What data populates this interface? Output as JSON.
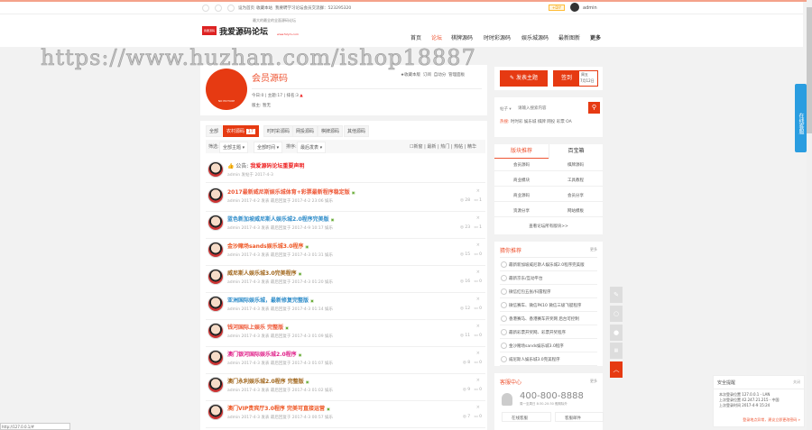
{
  "topbar": {
    "links": [
      "设为首页",
      "收藏本站",
      "我要聘学习论坛会员交流群：523295320"
    ],
    "badge": "+DIY",
    "user": "admin"
  },
  "header": {
    "logo_badge": "我要源码",
    "logo_text": "我爱源码论坛",
    "slogan": "最大的最全的全面源码论坛",
    "domain": "www.52ym.com"
  },
  "nav": [
    "首页",
    "论坛",
    "棋牌源码",
    "时时彩源码",
    "娱乐城源码",
    "最新图新",
    "更多"
  ],
  "watermark": "https://www.huzhan.com/ishop18887",
  "forum": {
    "title": "会员源码",
    "logo_text": "NO PICTURE",
    "stats": {
      "today_label": "今日:",
      "today": "0",
      "topics_label": "主题:",
      "topics": "17",
      "rank_label": "排名:",
      "rank": "3"
    },
    "moderator_label": "版主:",
    "moderator": "暂无",
    "actions": [
      "收藏本版",
      "订阅",
      "自动分",
      "管理面板"
    ]
  },
  "tabs": [
    "全部",
    "农村源码",
    "时时彩源码",
    "网投源码",
    "棋牌源码",
    "其他源码"
  ],
  "active_tab_count": "17",
  "filter": {
    "label": "筛选:",
    "type": "全部主题",
    "time": "全部时间",
    "sort_label": "排序:",
    "sort": "最后发表",
    "options": [
      "新窗",
      "最新",
      "热门",
      "热帖",
      "精华"
    ]
  },
  "announcement": {
    "prefix": "公告:",
    "title": "我爱源码论坛重要声明",
    "meta": "admin 发帖于 2017-4-3"
  },
  "topics": [
    {
      "title": "2017最新威尼斯娱乐城体育+彩票最新程序稳定版",
      "color": "#e53",
      "meta": "admin 2017-4-2 发表 最后回复于 2017-4-2 23:06 娱乐",
      "views": "28",
      "replies": "1"
    },
    {
      "title": "蓝色新加坡威尼斯人娱乐城2.0程序完美版",
      "color": "#2c8bc9",
      "meta": "admin 2017-4-3 发表 最后回复于 2017-4-9 10:17 娱乐",
      "views": "23",
      "replies": "1"
    },
    {
      "title": "金沙赌场sands娱乐城3.0程序",
      "color": "#ee5522",
      "meta": "admin 2017-4-3 发表 最后回复于 2017-4-3 01:31 娱乐",
      "views": "15",
      "replies": "0"
    },
    {
      "title": "威尼斯人娱乐城3.0完美程序",
      "color": "#a0651a",
      "meta": "admin 2017-4-3 发表 最后回复于 2017-4-3 01:20 娱乐",
      "views": "16",
      "replies": "0"
    },
    {
      "title": "亚洲国际娱乐城，最新修复完整版",
      "color": "#2c8bc9",
      "meta": "admin 2017-4-3 发表 最后回复于 2017-4-3 01:14 娱乐",
      "views": "12",
      "replies": "0"
    },
    {
      "title": "钱河国际上娱乐 完整版",
      "color": "#e53",
      "meta": "admin 2017-4-3 发表 最后回复于 2017-4-3 01:09 娱乐",
      "views": "11",
      "replies": "0"
    },
    {
      "title": "澳门银河国际娱乐城2.0程序",
      "color": "#e0218a",
      "meta": "admin 2017-4-3 发表 最后回复于 2017-4-3 01:07 娱乐",
      "views": "8",
      "replies": "0"
    },
    {
      "title": "澳门永利娱乐城2.0程序 完整版",
      "color": "#a0651a",
      "meta": "admin 2017-4-3 发表 最后回复于 2017-4-3 01:02 娱乐",
      "views": "9",
      "replies": "0"
    },
    {
      "title": "澳门VIP贵宾厅3.0程序 完美可直接运营",
      "color": "#ee5522",
      "meta": "admin 2017-4-3 发表 最后回复于 2017-4-3 00:57 娱乐",
      "views": "7",
      "replies": "0"
    }
  ],
  "sidebar": {
    "post_btn": "发表主题",
    "sign_btn": "签到",
    "sign_day": "周五",
    "sign_date": "7月12日",
    "search": {
      "type": "帖子",
      "placeholder": "请输入搜索内容",
      "hot_label": "热搜:",
      "hot": [
        "时时彩",
        "娱乐城",
        "棋牌",
        "网投",
        "彩票",
        "OA"
      ]
    },
    "tabs": [
      "版块推荐",
      "百宝箱"
    ],
    "boards": [
      "会员源码",
      "棋牌源码",
      "商业模块",
      "工具教程",
      "商业源码",
      "会员分享",
      "资源分享",
      "网站模板"
    ],
    "all_boards": "查看论坛所有版块>>",
    "rec_title": "猜你推荐",
    "rec_more": "更多",
    "rec": [
      "最新新加坡威尼斯人娱乐城2.0程序完美版",
      "最新京东/互动平台",
      "微信红包五张/扫雷程序",
      "微信赛车、微信PK10 微信三级飞艇程序",
      "香港赛马、香港赛车开奖网 后台可控制",
      "最新彩票开奖网、彩票开奖程序",
      "金沙赌场sands娱乐城3.0程序",
      "威尼斯人娱乐城3.0完美程序"
    ],
    "service_title": "客服中心",
    "service_more": "更多",
    "phone": "400-800-8888",
    "hours": "周一至周日 8:30-20:30 假期除外",
    "online": "在线客服",
    "email": "客服邮件"
  },
  "float": {
    "kefu": "在线客服"
  },
  "security": {
    "title": "安全提醒",
    "close": "关闭",
    "lines": [
      "本次登录位置 127.0.0.1 - LAN",
      "上次登录位置 42.247.21.215 - 中国",
      "上次登录时间 2017-4-9 15:24"
    ],
    "warn": "登录地点异常，建议立即更改密码 »"
  },
  "status": "http://127.0.0.1/#"
}
